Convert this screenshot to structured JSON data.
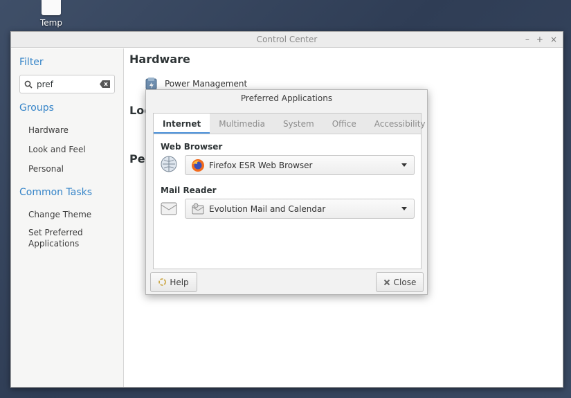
{
  "desktop": {
    "icon_label": "Temp"
  },
  "window": {
    "title": "Control Center",
    "controls": {
      "minimize": "–",
      "maximize": "+",
      "close": "×"
    }
  },
  "sidebar": {
    "filter_heading": "Filter",
    "search_value": "pref",
    "groups_heading": "Groups",
    "groups": [
      "Hardware",
      "Look and Feel",
      "Personal"
    ],
    "tasks_heading": "Common Tasks",
    "tasks": [
      "Change Theme",
      "Set Preferred Applications"
    ]
  },
  "content": {
    "hardware_heading": "Hardware",
    "power_management": "Power Management",
    "look_heading_partial": "Loo",
    "personal_heading_partial": "Per"
  },
  "dialog": {
    "title": "Preferred Applications",
    "tabs": [
      "Internet",
      "Multimedia",
      "System",
      "Office",
      "Accessibility"
    ],
    "active_tab": "Internet",
    "web_browser_label": "Web Browser",
    "web_browser_value": "Firefox ESR Web Browser",
    "mail_reader_label": "Mail Reader",
    "mail_reader_value": "Evolution Mail and Calendar",
    "help_label": "Help",
    "close_label": "Close"
  },
  "colors": {
    "accent": "#3584c8",
    "tab_underline": "#4a90d9"
  }
}
